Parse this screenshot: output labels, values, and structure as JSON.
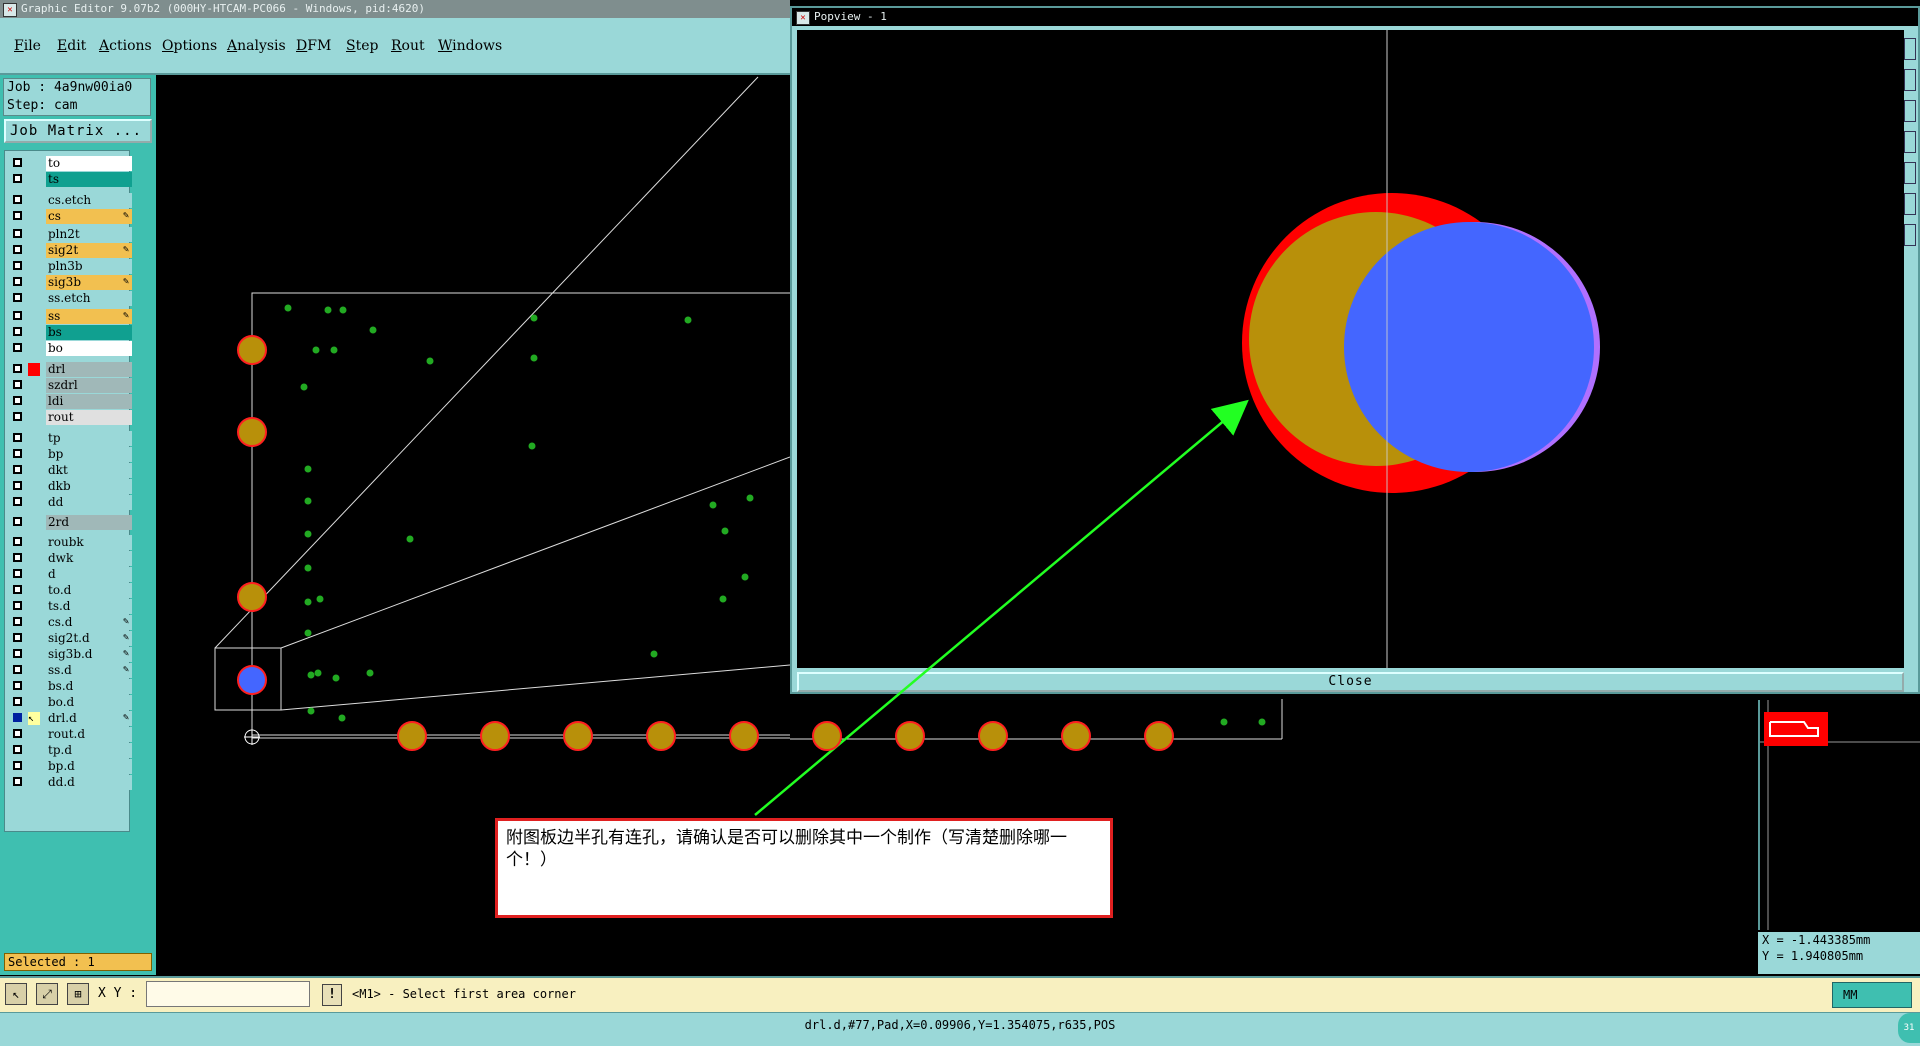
{
  "window": {
    "title": "Graphic Editor 9.07b2 (000HY-HTCAM-PC066 - Windows, pid:4620)"
  },
  "menu": [
    "File",
    "Edit",
    "Actions",
    "Options",
    "Analysis",
    "DFM",
    "Step",
    "Rout",
    "Windows"
  ],
  "job": {
    "job_line": "Job : 4a9nw00ia0",
    "step_line": "Step: cam",
    "matrix_button": "Job Matrix ..."
  },
  "layers": [
    {
      "name": "to",
      "color": "#ffffff"
    },
    {
      "name": "ts",
      "color": "#10a090"
    },
    {
      "name": "cs.etch",
      "color": "#9ad8d8"
    },
    {
      "name": "cs",
      "color": "#f2c050",
      "edit": true
    },
    {
      "name": "pln2t",
      "color": "#9ad8d8"
    },
    {
      "name": "sig2t",
      "color": "#f2c050",
      "edit": true
    },
    {
      "name": "pln3b",
      "color": "#9ad8d8"
    },
    {
      "name": "sig3b",
      "color": "#f2c050",
      "edit": true
    },
    {
      "name": "ss.etch",
      "color": "#9ad8d8"
    },
    {
      "name": "ss",
      "color": "#f2c050",
      "edit": true
    },
    {
      "name": "bs",
      "color": "#10a090"
    },
    {
      "name": "bo",
      "color": "#ffffff"
    },
    {
      "name": "drl",
      "color": "#a0b8b8",
      "swatch": "#ff0000"
    },
    {
      "name": "szdrl",
      "color": "#a0b8b8"
    },
    {
      "name": "ldi",
      "color": "#a0b8b8"
    },
    {
      "name": "rout",
      "color": "#e0e0e0"
    },
    {
      "name": "tp",
      "color": "#9ad8d8"
    },
    {
      "name": "bp",
      "color": "#9ad8d8"
    },
    {
      "name": "dkt",
      "color": "#9ad8d8"
    },
    {
      "name": "dkb",
      "color": "#9ad8d8"
    },
    {
      "name": "dd",
      "color": "#9ad8d8"
    },
    {
      "name": "2rd",
      "color": "#a0b8b8"
    },
    {
      "name": "roubk",
      "color": "#9ad8d8"
    },
    {
      "name": "dwk",
      "color": "#9ad8d8"
    },
    {
      "name": "d",
      "color": "#9ad8d8"
    },
    {
      "name": "to.d",
      "color": "#9ad8d8"
    },
    {
      "name": "ts.d",
      "color": "#9ad8d8"
    },
    {
      "name": "cs.d",
      "color": "#9ad8d8",
      "edit": true
    },
    {
      "name": "sig2t.d",
      "color": "#9ad8d8",
      "edit": true
    },
    {
      "name": "sig3b.d",
      "color": "#9ad8d8",
      "edit": true
    },
    {
      "name": "ss.d",
      "color": "#9ad8d8",
      "edit": true
    },
    {
      "name": "bs.d",
      "color": "#9ad8d8"
    },
    {
      "name": "bo.d",
      "color": "#9ad8d8"
    },
    {
      "name": "drl.d",
      "color": "#9ad8d8",
      "active": true,
      "edit": true
    },
    {
      "name": "rout.d",
      "color": "#9ad8d8"
    },
    {
      "name": "tp.d",
      "color": "#9ad8d8"
    },
    {
      "name": "bp.d",
      "color": "#9ad8d8"
    },
    {
      "name": "dd.d",
      "color": "#9ad8d8"
    }
  ],
  "selected_text": "Selected : 1",
  "popview": {
    "title": "Popview - 1",
    "close_label": "Close"
  },
  "coords": {
    "x": "X  = -1.443385mm",
    "y": "Y  =  1.940805mm"
  },
  "command": {
    "xy_label": "X Y :",
    "input_value": "",
    "prompt": "<M1> - Select first area corner",
    "units": "MM"
  },
  "status": "drl.d,#77,Pad,X=0.09906,Y=1.354075,r635,POS",
  "annotation": {
    "text": "附图板边半孔有连孔，请确认是否可以删除其中一个制作（写清楚删除哪一个！）"
  },
  "colors": {
    "panel": "#9ad8d8",
    "accent": "#3fbfb0",
    "copper": "#b8900a",
    "drill": "#ff0000",
    "highlight": "#4466ff",
    "dots": "#22aa22"
  },
  "icons": {
    "select": "cursor-icon",
    "zoom": "zoom-icon",
    "grid": "grid-icon",
    "info": "exclamation-icon"
  }
}
